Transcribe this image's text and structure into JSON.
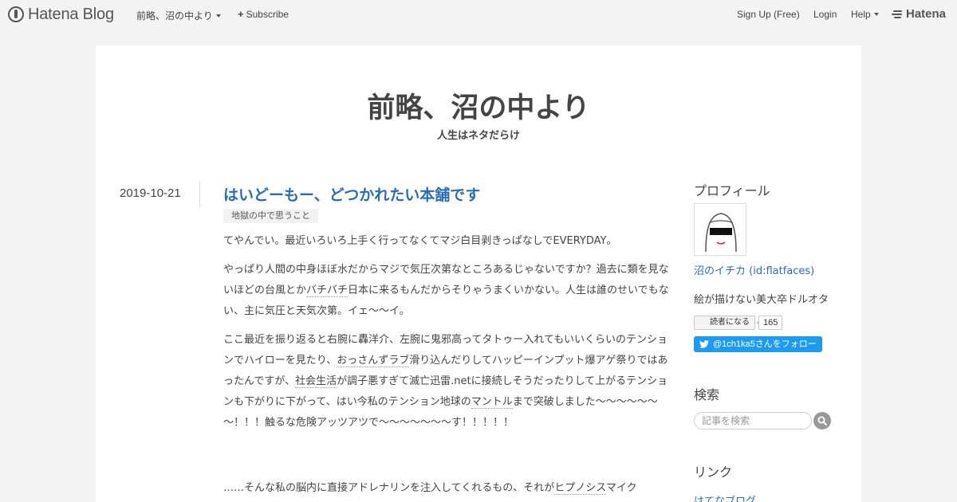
{
  "topbar": {
    "brand": "Hatena Blog",
    "blog_menu": "前略、沼の中より",
    "subscribe": "Subscribe",
    "signup": "Sign Up (Free)",
    "login": "Login",
    "help": "Help",
    "hatena": "Hatena"
  },
  "blog": {
    "title": "前略、沼の中より",
    "subtitle": "人生はネタだらけ"
  },
  "entry": {
    "date": "2019-10-21",
    "title": "はいどーもー、どつかれたい本舗です",
    "category": "地獄の中で思うこと",
    "p1": "てやんでい。最近いろいろ上手く行ってなくてマジ白目剥きっぱなしでEVERYDAY。",
    "p2_a": "やっぱり人間の中身ほぼ水だからマジで気圧次第なところあるじゃないですか？過去に類を見ないほどの台風とか",
    "p2_kw": "バチバチ",
    "p2_b": "日本に来るもんだからそりゃうまくいかない。人生は誰のせいでもない、主に気圧と天気次第。イェ〜〜イ。",
    "p3_a": "ここ最近を振り返ると右腕に轟洋介、左腕に鬼邪高ってタトゥー入れてもいいくらいのテンションでハイローを見たり、",
    "p3_kw1": "おっさんずラブ",
    "p3_b": "滑り込んだりしてハッピーインプット爆アゲ祭りではあったんですが、",
    "p3_kw2": "社会生活",
    "p3_c": "が調子悪すぎて滅亡迅雷.netに接続しそうだったりして上がるテンションも下がりに下がって、はい今私のテンション地球の",
    "p3_kw3": "マントル",
    "p3_d": "まで突破しました～～～～～～～！！！触るな危険アッツアツで～～～～～～～す！！！！！",
    "p4_a": "……そんな私の脳内に直接アドレナリンを注入してくれるもの、それが",
    "p4_kw": "ヒプノシス",
    "p4_b": "マイク"
  },
  "sidebar": {
    "profile_heading": "プロフィール",
    "profile_name": "沼のイチカ (id:flatfaces)",
    "profile_desc": "絵が描けない美大卒ドルオタ",
    "reader_button": "読者になる",
    "reader_count": "165",
    "follow_button": "@1ch1ka5さんをフォロー",
    "search_heading": "検索",
    "search_placeholder": "記事を検索",
    "links_heading": "リンク",
    "link_1": "はてなブログ"
  },
  "colors": {
    "link": "#2a6db5",
    "twitter": "#1d9bf0",
    "background": "#f3f3f3"
  }
}
